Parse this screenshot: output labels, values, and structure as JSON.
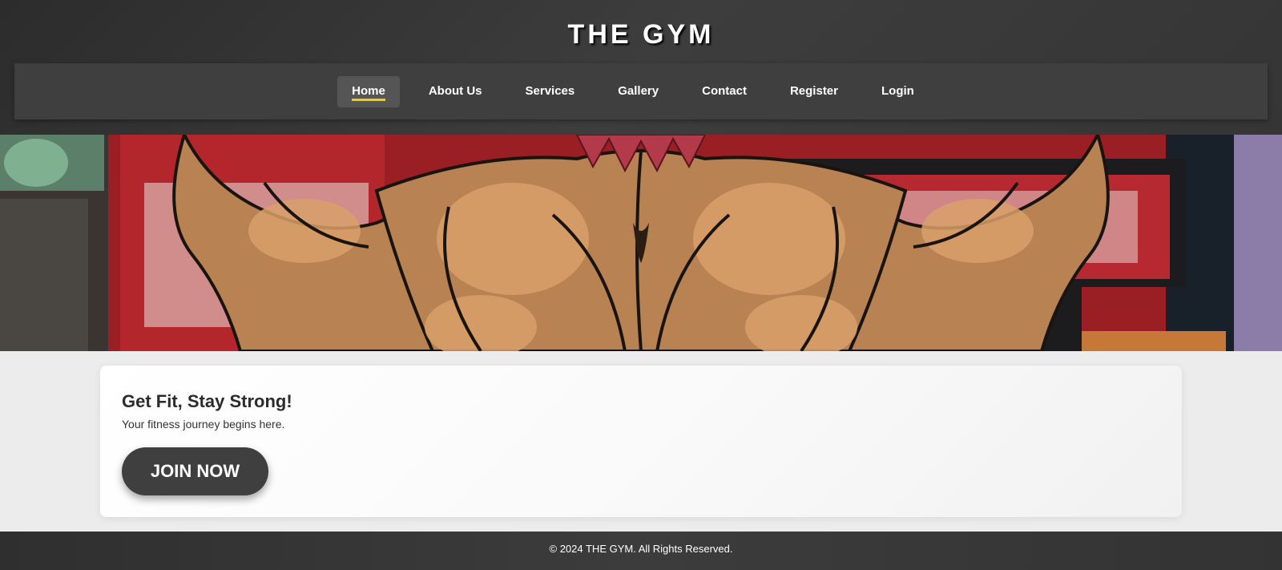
{
  "header": {
    "title": "THE GYM"
  },
  "nav": {
    "items": [
      {
        "label": "Home",
        "active": true
      },
      {
        "label": "About Us"
      },
      {
        "label": "Services"
      },
      {
        "label": "Gallery"
      },
      {
        "label": "Contact"
      },
      {
        "label": "Register"
      },
      {
        "label": "Login"
      }
    ],
    "active_indicator_color": "#f2d100"
  },
  "hero": {
    "image": "muscular-back-illustration"
  },
  "card": {
    "heading": "Get Fit, Stay Strong!",
    "subtext": "Your fitness journey begins here.",
    "button_label": "JOIN NOW"
  },
  "footer": {
    "text": "© 2024 THE GYM. All Rights Reserved."
  },
  "colors": {
    "header_bg": "#353535",
    "nav_bg": "#3f3f3f",
    "button_bg": "#3f3f3f",
    "page_bg": "#ececec"
  }
}
